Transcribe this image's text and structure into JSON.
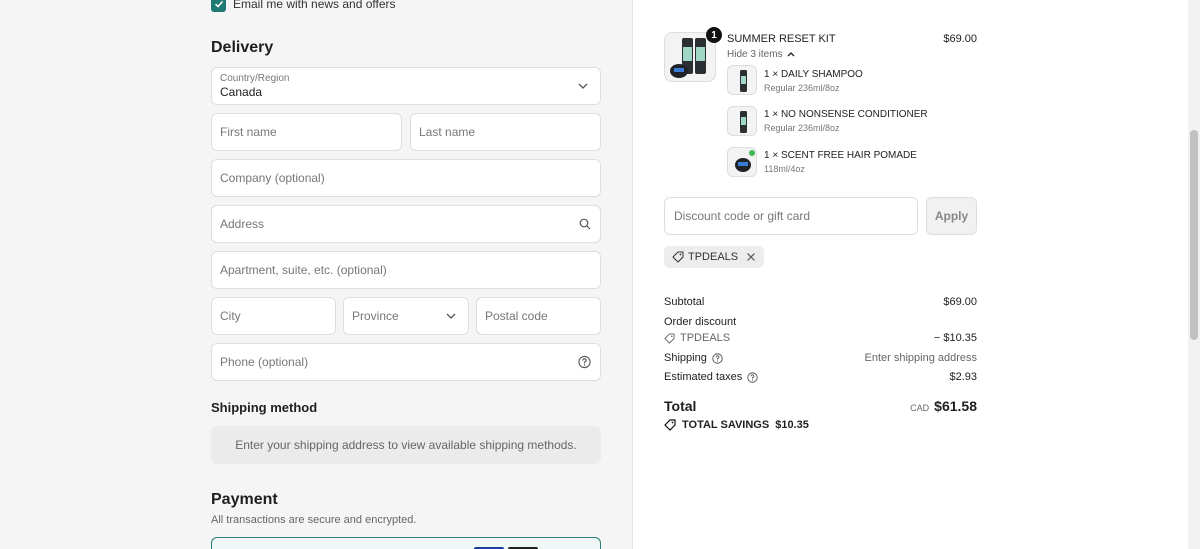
{
  "newsletter": {
    "label": "Email me with news and offers",
    "checked": true
  },
  "delivery": {
    "title": "Delivery",
    "country_label": "Country/Region",
    "country_value": "Canada",
    "first_name_placeholder": "First name",
    "last_name_placeholder": "Last name",
    "company_placeholder": "Company (optional)",
    "address_placeholder": "Address",
    "apartment_placeholder": "Apartment, suite, etc. (optional)",
    "city_placeholder": "City",
    "province_placeholder": "Province",
    "postal_placeholder": "Postal code",
    "phone_placeholder": "Phone (optional)"
  },
  "shipping_method": {
    "title": "Shipping method",
    "message": "Enter your shipping address to view available shipping methods."
  },
  "payment": {
    "title": "Payment",
    "subtitle": "All transactions are secure and encrypted."
  },
  "order": {
    "product": {
      "name": "SUMMER RESET KIT",
      "price": "$69.00",
      "quantity": "1",
      "toggle_label": "Hide 3 items"
    },
    "items": [
      {
        "title": "1 × DAILY SHAMPOO",
        "variant": "Regular 236ml/8oz"
      },
      {
        "title": "1 × NO NONSENSE CONDITIONER",
        "variant": "Regular 236ml/8oz"
      },
      {
        "title": "1 × SCENT FREE HAIR POMADE",
        "variant": "118ml/4oz"
      }
    ],
    "discount": {
      "placeholder": "Discount code or gift card",
      "apply_label": "Apply",
      "applied_code": "TPDEALS"
    },
    "summary": {
      "subtotal_label": "Subtotal",
      "subtotal_value": "$69.00",
      "order_discount_label": "Order discount",
      "discount_code": "TPDEALS",
      "discount_value": "− $10.35",
      "shipping_label": "Shipping",
      "shipping_value": "Enter shipping address",
      "taxes_label": "Estimated taxes",
      "taxes_value": "$2.93",
      "total_label": "Total",
      "total_currency": "CAD",
      "total_value": "$61.58",
      "savings_label": "TOTAL SAVINGS",
      "savings_value": "$10.35"
    }
  },
  "colors": {
    "accent": "#1f7a74",
    "background_left": "#f5f5f5"
  }
}
